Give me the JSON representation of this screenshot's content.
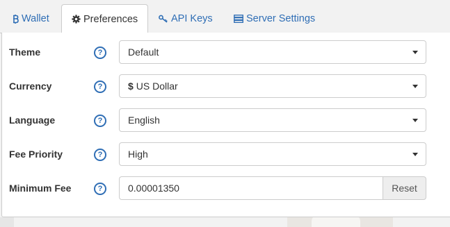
{
  "tabs": [
    {
      "label": "Wallet",
      "icon": "bitcoin-icon",
      "active": false
    },
    {
      "label": "Preferences",
      "icon": "gear-icon",
      "active": true
    },
    {
      "label": "API Keys",
      "icon": "key-icon",
      "active": false
    },
    {
      "label": "Server Settings",
      "icon": "server-icon",
      "active": false
    }
  ],
  "preferences": {
    "theme": {
      "label": "Theme",
      "value": "Default",
      "help": "?"
    },
    "currency": {
      "label": "Currency",
      "symbol": "$",
      "value": "US Dollar",
      "help": "?"
    },
    "language": {
      "label": "Language",
      "value": "English",
      "help": "?"
    },
    "fee_priority": {
      "label": "Fee Priority",
      "value": "High",
      "help": "?"
    },
    "minimum_fee": {
      "label": "Minimum Fee",
      "value": "0.00001350",
      "reset_label": "Reset",
      "help": "?"
    }
  },
  "colors": {
    "link": "#2f6eb5",
    "active_tab_text": "#333333",
    "border": "#cccccc",
    "page_background": "#f2f2f2"
  }
}
